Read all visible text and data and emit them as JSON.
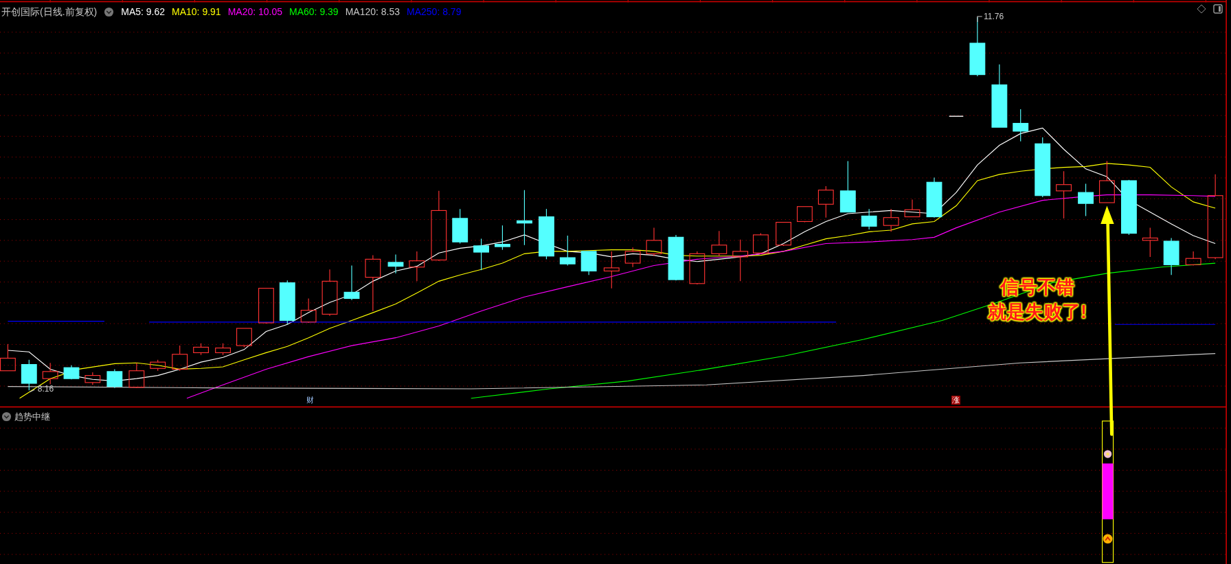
{
  "header": {
    "title": "开创国际(日线.前复权)",
    "moving_averages": [
      {
        "label": "MA5: 9.62",
        "color": "#ffffff"
      },
      {
        "label": "MA10: 9.91",
        "color": "#ffff00"
      },
      {
        "label": "MA20: 10.05",
        "color": "#ff00ff"
      },
      {
        "label": "MA60: 9.39",
        "color": "#00ff00"
      },
      {
        "label": "MA120: 8.53",
        "color": "#c8c8c8"
      },
      {
        "label": "MA250: 8.79",
        "color": "#0000ff"
      }
    ]
  },
  "price_labels": {
    "high": "11.76",
    "low": "8.16"
  },
  "event_markers": [
    {
      "label": "财",
      "kind": "finance"
    },
    {
      "label": "涨",
      "kind": "limit"
    }
  ],
  "annotation": [
    "信号不错",
    "就是失败了!"
  ],
  "indicator": {
    "title": "趋势中继"
  }
}
